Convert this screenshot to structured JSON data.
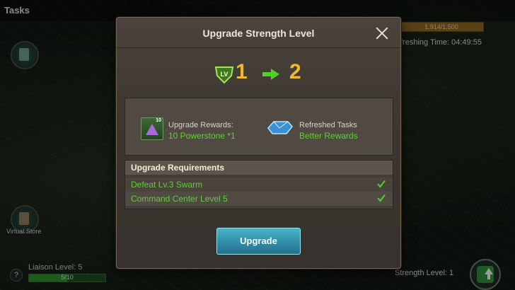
{
  "background": {
    "title": "Tasks",
    "progress": {
      "text": "1,914/1,500",
      "fraction": 1.0
    },
    "refreshing": "freshing Time: 04:49:55",
    "virtual_store_label": "Virtual Store",
    "liaison_level": "Liaison Level: 5",
    "liaison_progress": {
      "text": "5/10",
      "fraction": 0.5
    },
    "strength_level": "Strength Level: 1",
    "help_glyph": "?"
  },
  "modal": {
    "title": "Upgrade Strength Level",
    "lv_badge": "LV",
    "level_from": "1",
    "level_to": "2",
    "rewards": {
      "upgrade_label": "Upgrade Rewards:",
      "upgrade_value": "10 Powerstone *1",
      "powerstone_count": "10",
      "refresh_label": "Refreshed Tasks",
      "refresh_value": "Better Rewards"
    },
    "requirements": {
      "header": "Upgrade Requirements",
      "items": [
        {
          "text": "Defeat Lv.3 Swarm",
          "met": true
        },
        {
          "text": "Command Center Level 5",
          "met": true
        }
      ]
    },
    "button_label": "Upgrade"
  },
  "colors": {
    "accent_gold": "#f0b92a",
    "green_text": "#5fce34",
    "button_blue": "#2f8ea8"
  }
}
